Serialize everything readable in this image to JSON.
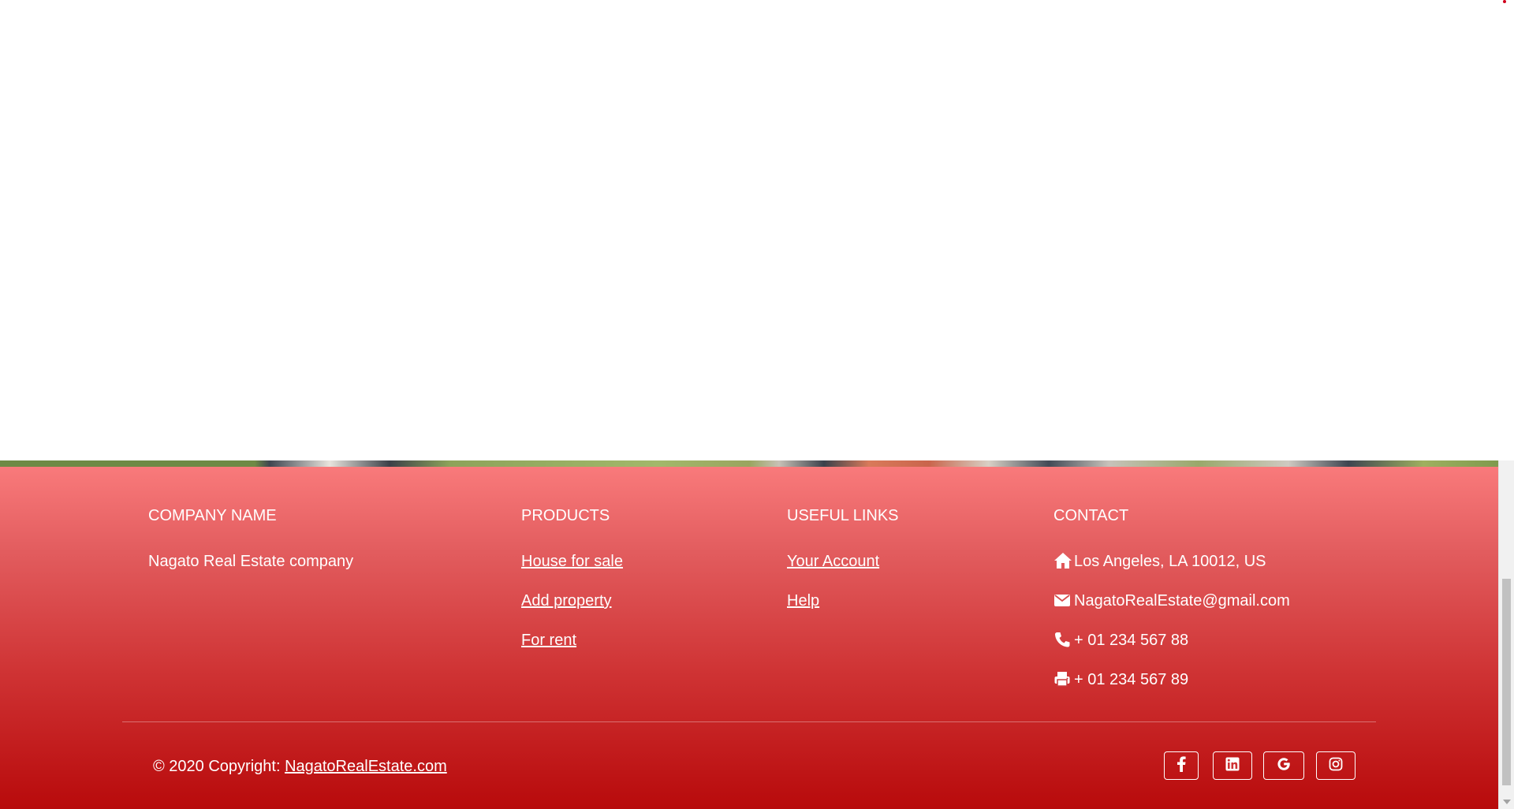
{
  "footer": {
    "company": {
      "heading": "COMPANY NAME",
      "text": "Nagato Real Estate company"
    },
    "products": {
      "heading": "PRODUCTS",
      "links": [
        "House for sale",
        "Add property",
        "For rent"
      ]
    },
    "useful_links": {
      "heading": "USEFUL LINKS",
      "links": [
        "Your Account",
        "Help"
      ]
    },
    "contact": {
      "heading": "CONTACT",
      "address": "Los Angeles, LA 10012, US",
      "email": "NagatoRealEstate@gmail.com",
      "phone": "+ 01 234 567 88",
      "fax": "+ 01 234 567 89",
      "icons": [
        "home-icon",
        "envelope-icon",
        "phone-icon",
        "printer-icon"
      ]
    },
    "copyright": {
      "prefix": "© 2020 Copyright:",
      "link": "NagatoRealEstate.com"
    },
    "social": [
      "facebook-icon",
      "linkedin-icon",
      "google-icon",
      "instagram-icon"
    ]
  },
  "colors": {
    "footer_gradient_top": "#f97a7b",
    "footer_gradient_bottom": "#b80a0b",
    "text": "#ffffff"
  }
}
